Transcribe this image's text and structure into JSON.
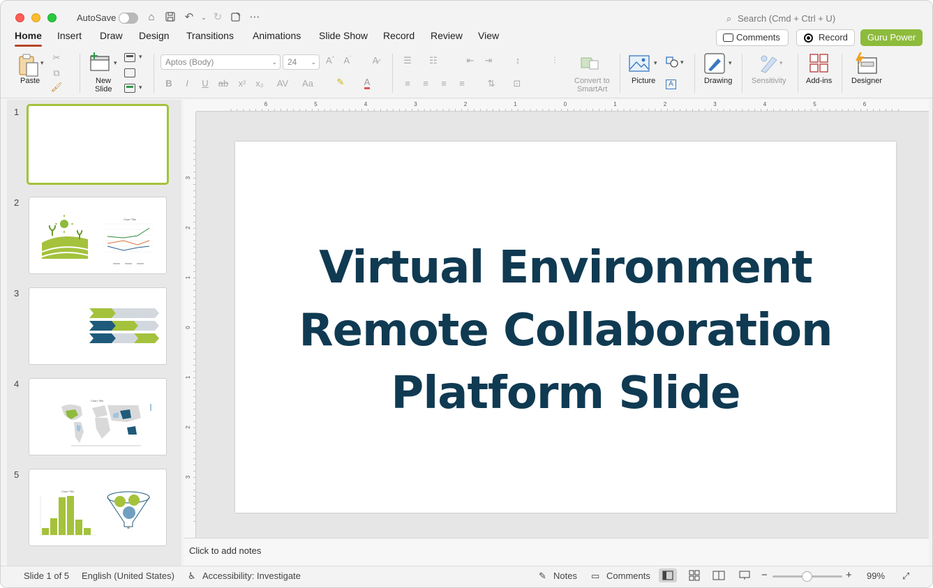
{
  "titlebar": {
    "autosave_label": "AutoSave",
    "search_placeholder": "Search (Cmd + Ctrl + U)"
  },
  "tabs": [
    {
      "label": "Home",
      "active": true
    },
    {
      "label": "Insert"
    },
    {
      "label": "Draw"
    },
    {
      "label": "Design"
    },
    {
      "label": "Transitions"
    },
    {
      "label": "Animations"
    },
    {
      "label": "Slide Show"
    },
    {
      "label": "Record"
    },
    {
      "label": "Review"
    },
    {
      "label": "View"
    }
  ],
  "header_buttons": {
    "comments": "Comments",
    "record": "Record",
    "guru": "Guru Power"
  },
  "ribbon": {
    "paste": "Paste",
    "new_slide_1": "New",
    "new_slide_2": "Slide",
    "font_name": "Aptos (Body)",
    "font_size": "24",
    "convert_1": "Convert to",
    "convert_2": "SmartArt",
    "picture": "Picture",
    "drawing": "Drawing",
    "sensitivity": "Sensitivity",
    "addins": "Add-ins",
    "designer": "Designer"
  },
  "thumbnails": [
    {
      "number": "1"
    },
    {
      "number": "2"
    },
    {
      "number": "3"
    },
    {
      "number": "4"
    },
    {
      "number": "5"
    }
  ],
  "ruler_h_labels": [
    "6",
    "5",
    "4",
    "3",
    "2",
    "1",
    "0",
    "1",
    "2",
    "3",
    "4",
    "5",
    "6"
  ],
  "ruler_v_labels": [
    "3",
    "2",
    "1",
    "0",
    "1",
    "2",
    "3"
  ],
  "slide": {
    "title_lines": [
      "Virtual Environment",
      "Remote Collaboration",
      "Platform Slide"
    ],
    "title_color": "#0f3a52"
  },
  "notes_placeholder": "Click to add notes",
  "status": {
    "slide_info": "Slide 1 of 5",
    "language": "English (United States)",
    "accessibility": "Accessibility: Investigate",
    "notes": "Notes",
    "comments": "Comments",
    "zoom": "99%"
  },
  "colors": {
    "accent_tab": "#b7472a",
    "guru_green": "#8dbb3c",
    "selected_thumb": "#a4c23c"
  }
}
